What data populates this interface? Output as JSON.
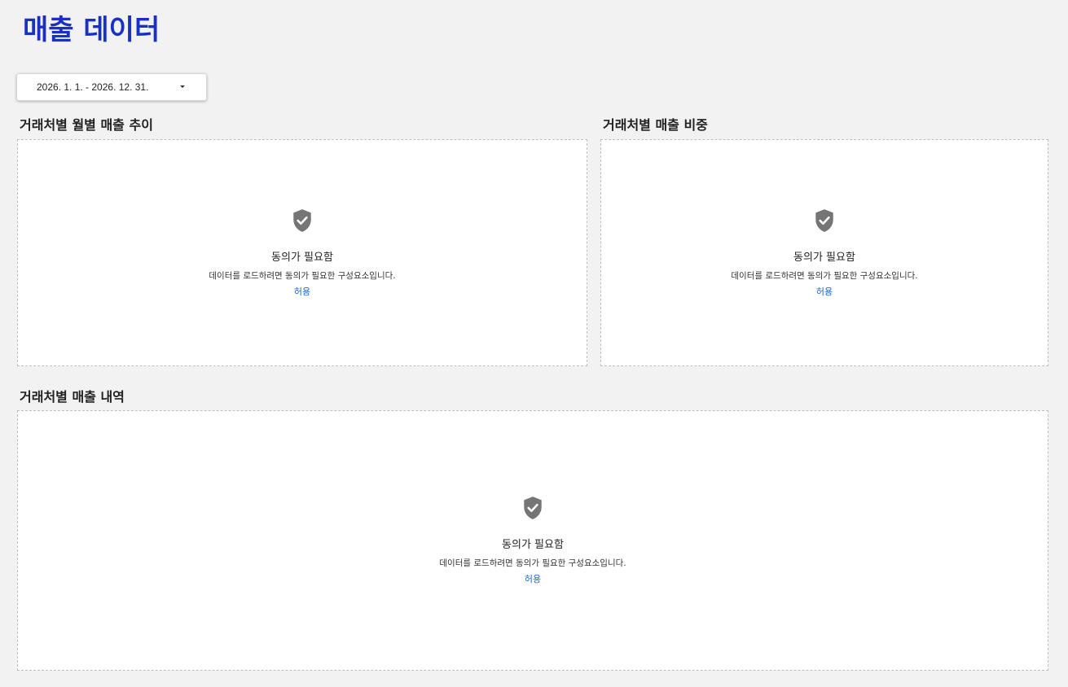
{
  "page": {
    "title": "매출 데이터"
  },
  "date_filter": {
    "value": "2026. 1. 1. - 2026. 12. 31.",
    "icon": "caret-down-icon"
  },
  "sections": [
    {
      "title": "거래처별 월별 매출 추이",
      "consent": {
        "icon": "shield-check-icon",
        "title": "동의가 필요함",
        "description": "데이터를 로드하려면 동의가 필요한 구성요소입니다.",
        "action": "허용"
      }
    },
    {
      "title": "거래처별 매출 비중",
      "consent": {
        "icon": "shield-check-icon",
        "title": "동의가 필요함",
        "description": "데이터를 로드하려면 동의가 필요한 구성요소입니다.",
        "action": "허용"
      }
    },
    {
      "title": "거래처별 매출 내역",
      "consent": {
        "icon": "shield-check-icon",
        "title": "동의가 필요함",
        "description": "데이터를 로드하려면 동의가 필요한 구성요소입니다.",
        "action": "허용"
      }
    }
  ],
  "colors": {
    "title": "#1a2fc4",
    "link": "#1a66cc",
    "background": "#f2f2f2",
    "icon": "#757575"
  }
}
